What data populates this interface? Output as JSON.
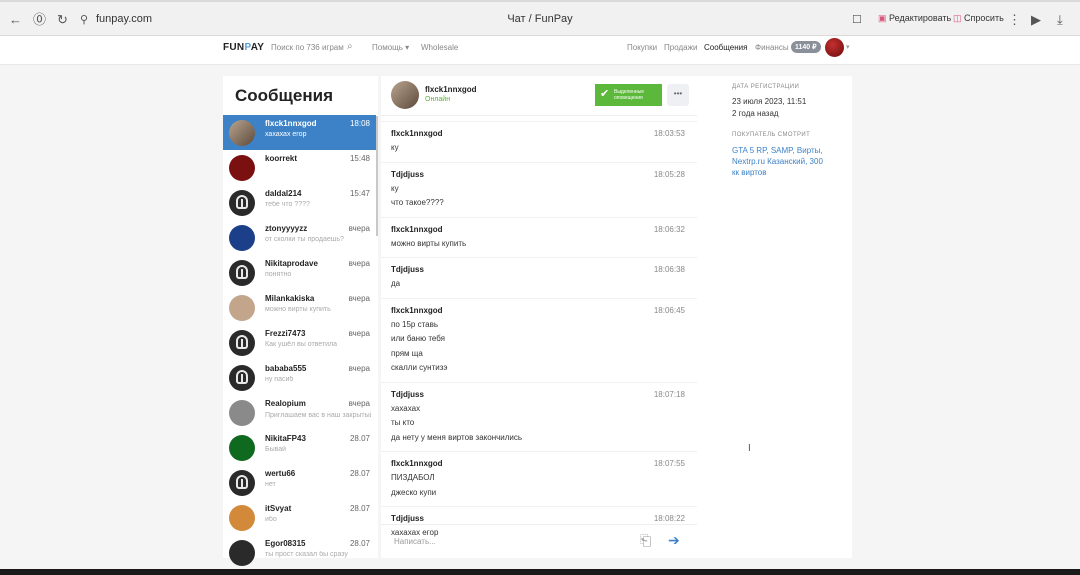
{
  "browser": {
    "url": "funpay.com",
    "tab_title": "Чат / FunPay",
    "edit_label": "Редактировать",
    "ask_label": "Спросить"
  },
  "header": {
    "logo_pre": "FUN",
    "logo_o": "P",
    "logo_post": "AY",
    "search_placeholder": "Поиск по 736 играм",
    "help": "Помощь",
    "wholesale": "Wholesale",
    "purchases": "Покупки",
    "sales": "Продажи",
    "messages": "Сообщения",
    "finance": "Финансы",
    "balance": "1140 ₽"
  },
  "sidebar": {
    "title": "Сообщения",
    "contacts": [
      {
        "name": "flxck1nnxgod",
        "time": "18:08",
        "preview": "хахахах егор"
      },
      {
        "name": "koorrekt",
        "time": "15:48",
        "preview": ""
      },
      {
        "name": "daldal214",
        "time": "15:47",
        "preview": "тебе что ????"
      },
      {
        "name": "ztonyyyyzz",
        "time": "вчера",
        "preview": "от сколки ты продаешь?"
      },
      {
        "name": "Nikitaprodave",
        "time": "вчера",
        "preview": "понятно"
      },
      {
        "name": "Milankakiska",
        "time": "вчера",
        "preview": "можно вирты купить"
      },
      {
        "name": "Frezzi7473",
        "time": "вчера",
        "preview": "Как ушёл вы ответила"
      },
      {
        "name": "bababa555",
        "time": "вчера",
        "preview": "ну пасиб"
      },
      {
        "name": "Realopium",
        "time": "вчера",
        "preview": "Приглашаем вас в наш закрытый Telegram 😎"
      },
      {
        "name": "NikitaFP43",
        "time": "28.07",
        "preview": "Бывай"
      },
      {
        "name": "wertu66",
        "time": "28.07",
        "preview": "нет"
      },
      {
        "name": "itSvyat",
        "time": "28.07",
        "preview": "ибо"
      },
      {
        "name": "Egor08315",
        "time": "28.07",
        "preview": "ты прост сказал бы сразу"
      }
    ]
  },
  "chat": {
    "partner_name": "flxck1nnxgod",
    "partner_status": "Онлайн",
    "verified_line1": "Выделенные",
    "verified_line2": "оповещения",
    "more_label": "•••",
    "messages": [
      {
        "author": "flxck1nnxgod",
        "time": "18:03:53",
        "lines": [
          "ку"
        ]
      },
      {
        "author": "Tdjdjuss",
        "time": "18:05:28",
        "lines": [
          "ку",
          "что такое????"
        ]
      },
      {
        "author": "flxck1nnxgod",
        "time": "18:06:32",
        "lines": [
          "можно вирты купить"
        ]
      },
      {
        "author": "Tdjdjuss",
        "time": "18:06:38",
        "lines": [
          "да"
        ]
      },
      {
        "author": "flxck1nnxgod",
        "time": "18:06:45",
        "lines": [
          "по 15р ставь",
          "или баню тебя",
          "прям ща",
          "скалли сунтизэ"
        ]
      },
      {
        "author": "Tdjdjuss",
        "time": "18:07:18",
        "lines": [
          "хахахах",
          "ты кто",
          "да нету у меня виртов закончились"
        ]
      },
      {
        "author": "flxck1nnxgod",
        "time": "18:07:55",
        "lines": [
          "ПИЗДАБОЛ",
          "джеско купи"
        ]
      },
      {
        "author": "Tdjdjuss",
        "time": "18:08:22",
        "lines": [
          "хахахах егор"
        ]
      }
    ],
    "composer_placeholder": "Написать..."
  },
  "info": {
    "reg_label": "ДАТА РЕГИСТРАЦИИ",
    "reg_date": "23 июля 2023, 11:51",
    "reg_ago": "2 года назад",
    "viewing_label": "ПОКУПАТЕЛЬ СМОТРИТ",
    "viewing_text": "GTA 5 RP, SAMP, Вирты, Nextrp.ru Казанский, 300 кк виртов"
  }
}
